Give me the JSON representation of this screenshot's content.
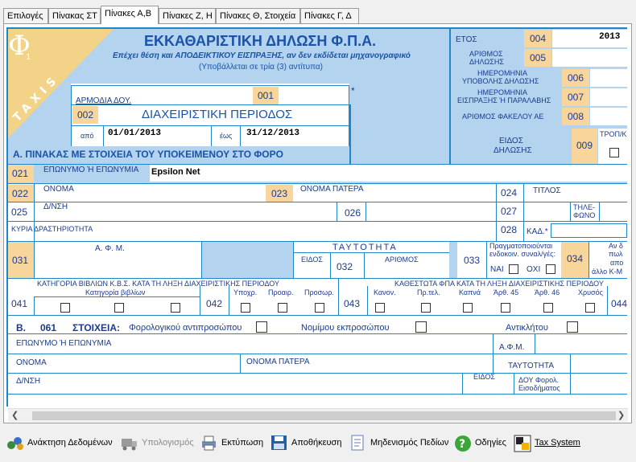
{
  "tabs": [
    {
      "label": "Επιλογές"
    },
    {
      "label": "Πίνακας ΣΤ"
    },
    {
      "label": "Πίνακες Α,Β"
    },
    {
      "label": "Πίνακες Ζ, Η"
    },
    {
      "label": "Πίνακες Θ, Στοιχεία"
    },
    {
      "label": "Πίνακες Γ, Δ"
    }
  ],
  "header": {
    "phi": "Φ",
    "phi_sub": "1",
    "taxis": "TAXIS",
    "title": "ΕΚΚΑΘΑΡΙΣΤΙΚΗ ΔΗΛΩΣΗ Φ.Π.Α.",
    "subtitle": "Επέχει θέση και ΑΠΟΔΕΙΚΤΙΚΟΥ ΕΙΣΠΡΑΞΗΣ, αν δεν εκδίδεται μηχανογραφικό",
    "note": "(Υποβάλλεται σε τρία (3) αντίτυπα)"
  },
  "right_block": {
    "etos_label": "ΕΤΟΣ",
    "etos_code": "004",
    "etos_value": "2013",
    "arithmos_label_1": "ΑΡΙΘΜΟΣ",
    "arithmos_label_2": "ΔΗΛΩΣΗΣ",
    "arithmos_code": "005",
    "hm_ypovolis_1": "ΗΜΕΡΟΜΗΝΙΑ",
    "hm_ypovolis_2": "ΥΠΟΒΟΛΗΣ ΔΗΛΩΣΗΣ",
    "hm_ypovolis_code": "006",
    "hm_eispraxis_1": "ΗΜΕΡΟΜΗΝΙΑ",
    "hm_eispraxis_2": "ΕΙΣΠΡΑΞΗΣ Ή ΠΑΡΑΛΑΒΗΣ",
    "hm_eispraxis_code": "007",
    "fakelos_label": "ΑΡΙΘΜΟΣ ΦΑΚΕΛΟΥ ΑΕ",
    "fakelos_code": "008",
    "eidos_1": "ΕΙΔΟΣ",
    "eidos_2": "ΔΗΛΩΣΗΣ",
    "eidos_code": "009",
    "trop_label": "ΤΡΟΠ/Κ"
  },
  "doy": {
    "label": "ΑΡΜΟΔΙΑ ΔΟΥ.",
    "code": "001",
    "asterisk": "*",
    "period_code": "002",
    "period_label": "ΔΙΑΧΕΙΡΙΣΤΙΚΗ ΠΕΡΙΟΔΟΣ",
    "from_label": "από",
    "from_value": "01/01/2013",
    "to_label": "έως",
    "to_value": "31/12/2013"
  },
  "section_a": {
    "title": "Α. ΠΙΝΑΚΑΣ ΜΕ ΣΤΟΙΧΕΙΑ ΤΟΥ ΥΠΟΚΕΙΜΕΝΟΥ ΣΤΟ ΦΟΡΟ",
    "c021": "021",
    "eponymo_label": "ΕΠΩΝΥΜΟ Ή ΕΠΩΝΥΜΙΑ",
    "eponymo_value": "Epsilon Net",
    "c022": "022",
    "onoma_label": "ΟΝΟΜΑ",
    "c023": "023",
    "onoma_patera_label": "ΟΝΟΜΑ ΠΑΤΕΡΑ",
    "c024": "024",
    "titlos_label": "ΤΙΤΛΟΣ",
    "c025": "025",
    "dnsi_label": "Δ/ΝΣΗ",
    "c026": "026",
    "c027": "027",
    "tilefono_1": "ΤΗΛΕ-",
    "tilefono_2": "ΦΩΝΟ",
    "kyria_label": "ΚΥΡΙΑ ΔΡΑΣΤΗΡΙΟΤΗΤΑ",
    "c028": "028",
    "kad_label": "ΚΑΔ.*",
    "c031": "031",
    "afm_label": "Α. Φ. Μ.",
    "tautotita_label": "ΤΑΥΤΟΤΗΤΑ",
    "eidos_label": "ΕΙΔΟΣ",
    "c032": "032",
    "arithmos_label": "ΑΡΙΘΜΟΣ",
    "c033": "033",
    "pragm_1": "Πραγματοποιούνται",
    "pragm_2": "ενδοκοιν. συναλ/γές:",
    "nai_label": "ΝΑΙ",
    "oxi_label": "ΟΧΙ",
    "c034": "034",
    "right_note_1": "Αν δ",
    "right_note_2": "πωλ",
    "right_note_3": "απο",
    "right_note_4": "άλλο Κ-Μ"
  },
  "row_041": {
    "kbs_header": "ΚΑΤΗΓΟΡΙΑ ΒΙΒΛΙΩΝ Κ.Β.Σ. ΚΑΤΑ ΤΗ ΛΗΞΗ ΔΙΑΧΕΙΡΙΣΤΙΚΗΣ ΠΕΡΙΟΔΟΥ",
    "fpa_header": "ΚΑΘΕΣΤΩΤΑ ΦΠΑ ΚΑΤΑ ΤΗ ΛΗΞΗ ΔΙΑΧΕΙΡΙΣΤΙΚΗΣ ΠΕΡΙΟΔΟΥ",
    "c041": "041",
    "katigoria_label": "Κατηγορία βιβλίων",
    "c042": "042",
    "ypoxr": "Υποχρ.",
    "proair": "Προαιρ.",
    "prosor": "Προσωρ.",
    "c043": "043",
    "kanon": "Κανον.",
    "prtel": "Πρ.τελ.",
    "kapna": "Καπνά",
    "arth45": "Άρθ. 45",
    "arth46": "Άρθ. 46",
    "xrysos": "Χρυσός",
    "c044": "044"
  },
  "section_b": {
    "letter": "Β.",
    "c061": "061",
    "stoixeia": "ΣΤΟΙΧΕΙΑ:",
    "forologikou": "Φορολογικού αντιπροσώπου",
    "nomimou": "Νομίμου εκπροσώπου",
    "antiklitou": "Αντικλήτου",
    "eponymo_label": "ΕΠΩΝΥΜΟ Ή ΕΠΩΝΥΜΙΑ",
    "afm_label": "Α.Φ.Μ.",
    "onoma_label": "ΟΝΟΜΑ",
    "onoma_patera_label": "ΟΝΟΜΑ ΠΑΤΕΡΑ",
    "tautotita_label": "ΤΑΥΤΟΤΗΤΑ",
    "dnsi_label": "Δ/ΝΣΗ",
    "eidos_label": "ΕΙΔΟΣ",
    "doy_forol_1": "ΔΟΥ Φορολ.",
    "doy_forol_2": "Εισοδήματος"
  },
  "toolbar": {
    "retrieve": "Ανάκτηση Δεδομένων",
    "calc": "Υπολογισμός",
    "print": "Εκτύπωση",
    "save": "Αποθήκευση",
    "clear": "Μηδενισμός Πεδίων",
    "help": "Οδηγίες",
    "taxsystem": "Tax System"
  },
  "colors": {
    "accent_blue": "#1f86c9",
    "header_blue": "#b3d3ef",
    "code_orange": "#f8d59b",
    "corner_yellow": "#f2d388"
  }
}
